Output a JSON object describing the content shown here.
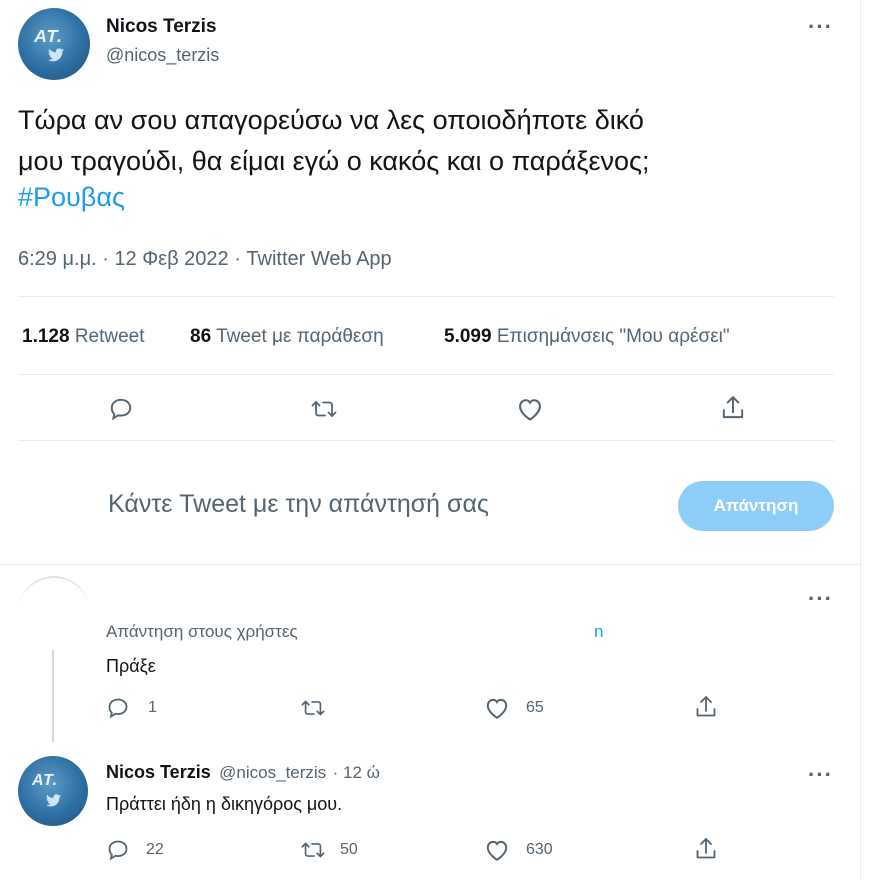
{
  "tweet": {
    "author_name": "Nicos Terzis",
    "author_handle": "@nicos_terzis",
    "avatar_text": "ΑΤ.",
    "text_line1": "Τώρα αν σου απαγορεύσω να λες οποιοδήποτε δικό",
    "text_line2": "μου τραγούδι, θα είμαι εγώ ο κακός και ο παράξενος;",
    "hashtag": "#Ρουβας",
    "timestamp": "6:29 μ.μ. · 12 Φεβ 2022 · Twitter Web App",
    "more_label": "···"
  },
  "stats": {
    "retweets_count": "1.128",
    "retweets_label": "Retweet",
    "quotes_count": "86",
    "quotes_label": "Tweet με παράθεση",
    "likes_count": "5.099",
    "likes_label": "Επισημάνσεις \"Μου αρέσει\""
  },
  "compose": {
    "placeholder": "Κάντε Tweet με την απάντησή σας",
    "button_label": "Απάντηση"
  },
  "replies": [
    {
      "reply_to_label": "Απάντηση στους χρήστες",
      "reply_to_tail": "n",
      "text": "Πράξε",
      "reply_count": "1",
      "retweet_count": "",
      "like_count": "65",
      "more_label": "···"
    },
    {
      "author_name": "Nicos Terzis",
      "author_handle": "@nicos_terzis",
      "time": "· 12 ώ",
      "avatar_text": "ΑΤ.",
      "text": "Πράττει ήδη η δικηγόρος μου.",
      "reply_count": "22",
      "retweet_count": "50",
      "like_count": "630",
      "more_label": "···"
    }
  ],
  "colors": {
    "accent": "#1d9bf0",
    "reply_button": "#8ecdf7",
    "secondary_text": "#536471",
    "divider": "#e6ecf0"
  },
  "icons": [
    "reply-icon",
    "retweet-icon",
    "like-icon",
    "share-icon",
    "more-icon",
    "bird-icon"
  ]
}
